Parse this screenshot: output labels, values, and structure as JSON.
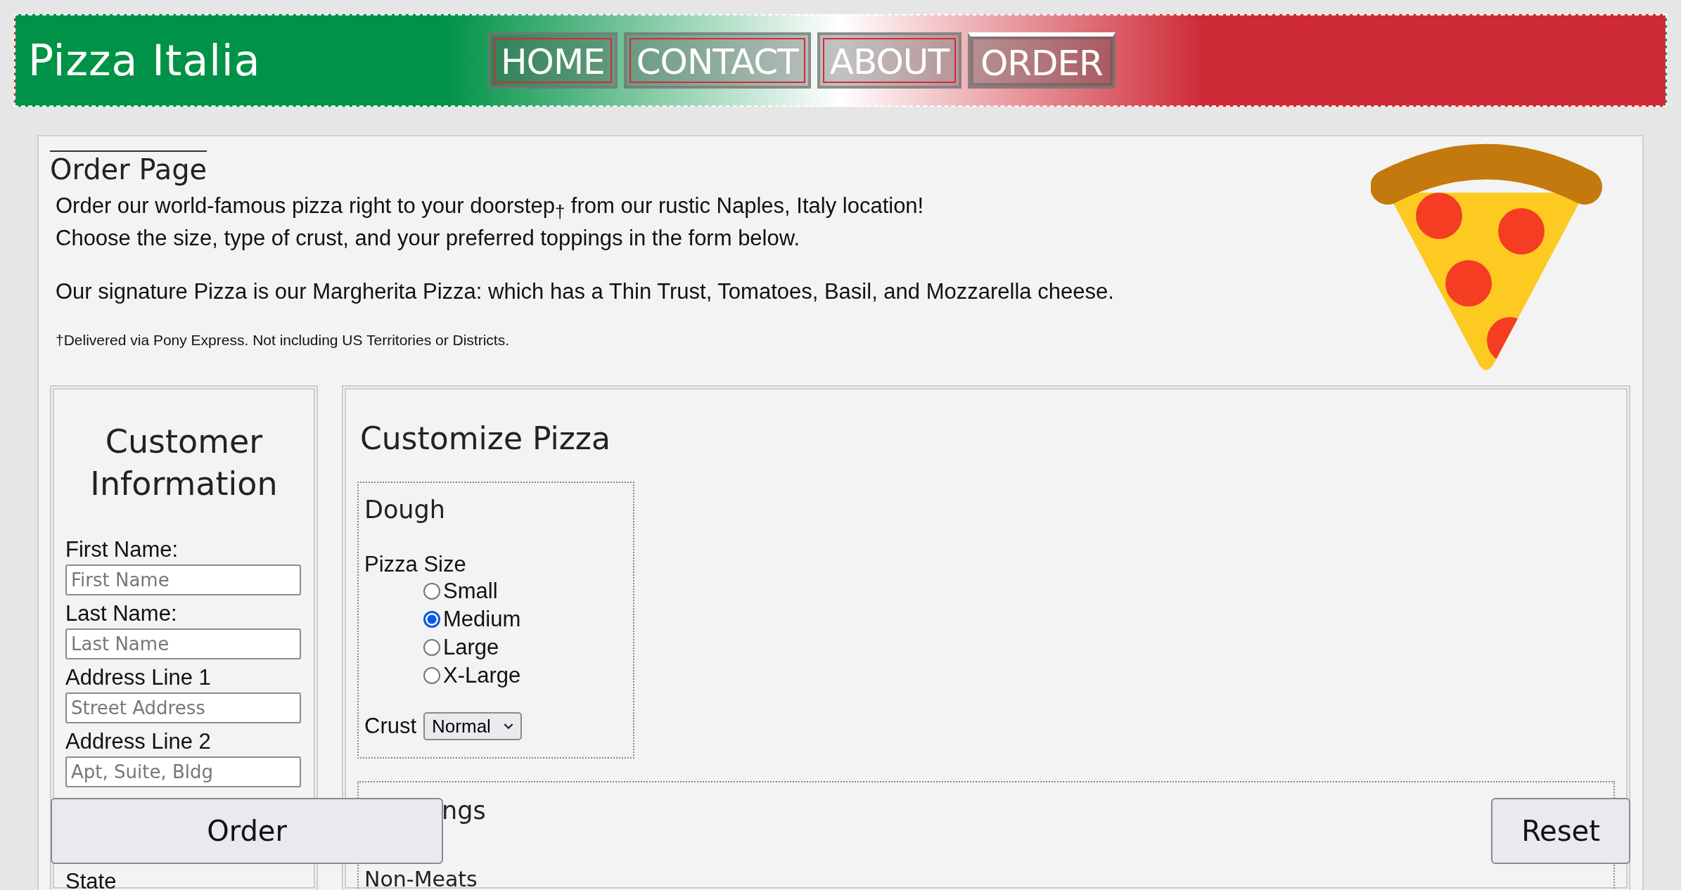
{
  "site": {
    "title": "Pizza Italia"
  },
  "nav": [
    {
      "label": "HOME",
      "selected": false
    },
    {
      "label": "CONTACT",
      "selected": false
    },
    {
      "label": "ABOUT",
      "selected": false
    },
    {
      "label": "ORDER",
      "selected": true
    }
  ],
  "intro": {
    "heading": "Order Page",
    "paragraph": [
      "Order our world-famous pizza right to your doorstep$_{†}$ from our rustic Naples, Italy location!",
      "Choose the size, type of crust, and your preferred toppings in the form below."
    ],
    "signature": "Our signature Pizza is our Margherita Pizza: which has a Thin Trust, Tomatoes, Basil, and Mozzarella cheese.",
    "footnote": "†Delivered via Pony Express. Not including US Territories or Districts."
  },
  "customer": {
    "heading": "Customer Information",
    "fields": [
      {
        "label": "First Name:",
        "placeholder": "First Name"
      },
      {
        "label": "Last Name:",
        "placeholder": "Last Name"
      },
      {
        "label": "Address Line 1",
        "placeholder": "Street Address"
      },
      {
        "label": "Address Line 2",
        "placeholder": "Apt, Suite, Bldg"
      },
      {
        "label": "State"
      }
    ]
  },
  "customize": {
    "heading": "Customize Pizza",
    "dough": {
      "heading": "Dough",
      "size_label": "Pizza Size",
      "sizes": [
        {
          "label": "Small",
          "selected": false
        },
        {
          "label": "Medium",
          "selected": true
        },
        {
          "label": "Large",
          "selected": false
        },
        {
          "label": "X-Large",
          "selected": false
        }
      ],
      "crust_label": "Crust",
      "crust": "Normal"
    },
    "toppings": {
      "heading": "ngs",
      "group": "Non-Meats"
    }
  },
  "buttons": [
    {
      "kind": "order",
      "label": "Order"
    },
    {
      "kind": "reset",
      "label": "Reset"
    }
  ]
}
